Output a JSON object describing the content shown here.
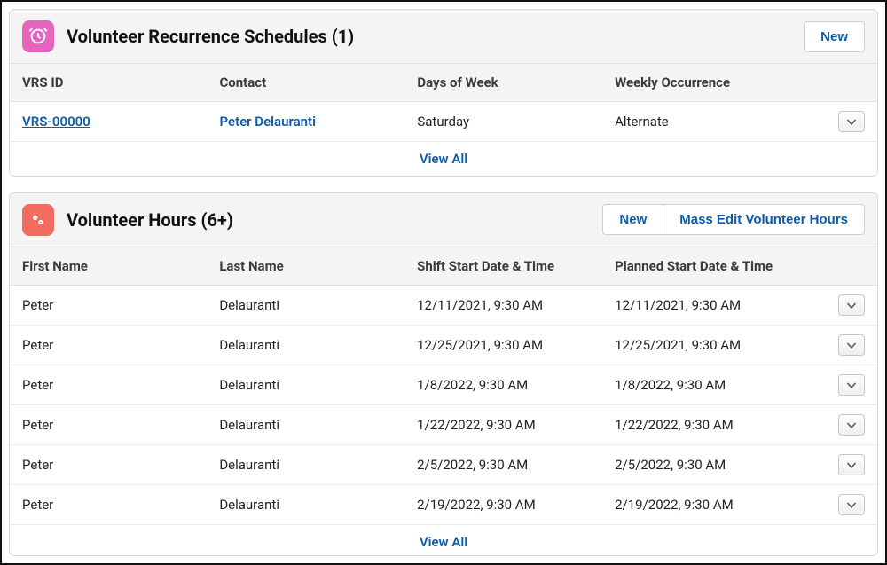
{
  "schedules": {
    "title": "Volunteer Recurrence Schedules (1)",
    "new_label": "New",
    "columns": [
      "VRS ID",
      "Contact",
      "Days of Week",
      "Weekly Occurrence"
    ],
    "rows": [
      {
        "id": "VRS-00000",
        "contact": "Peter Delauranti",
        "days": "Saturday",
        "occurrence": "Alternate"
      }
    ],
    "view_all": "View All"
  },
  "hours": {
    "title": "Volunteer Hours (6+)",
    "new_label": "New",
    "mass_edit_label": "Mass Edit Volunteer Hours",
    "columns": [
      "First Name",
      "Last Name",
      "Shift Start Date & Time",
      "Planned Start Date & Time"
    ],
    "rows": [
      {
        "first": "Peter",
        "last": "Delauranti",
        "shift": "12/11/2021, 9:30 AM",
        "planned": "12/11/2021, 9:30 AM"
      },
      {
        "first": "Peter",
        "last": "Delauranti",
        "shift": "12/25/2021, 9:30 AM",
        "planned": "12/25/2021, 9:30 AM"
      },
      {
        "first": "Peter",
        "last": "Delauranti",
        "shift": "1/8/2022, 9:30 AM",
        "planned": "1/8/2022, 9:30 AM"
      },
      {
        "first": "Peter",
        "last": "Delauranti",
        "shift": "1/22/2022, 9:30 AM",
        "planned": "1/22/2022, 9:30 AM"
      },
      {
        "first": "Peter",
        "last": "Delauranti",
        "shift": "2/5/2022, 9:30 AM",
        "planned": "2/5/2022, 9:30 AM"
      },
      {
        "first": "Peter",
        "last": "Delauranti",
        "shift": "2/19/2022, 9:30 AM",
        "planned": "2/19/2022, 9:30 AM"
      }
    ],
    "view_all": "View All"
  }
}
